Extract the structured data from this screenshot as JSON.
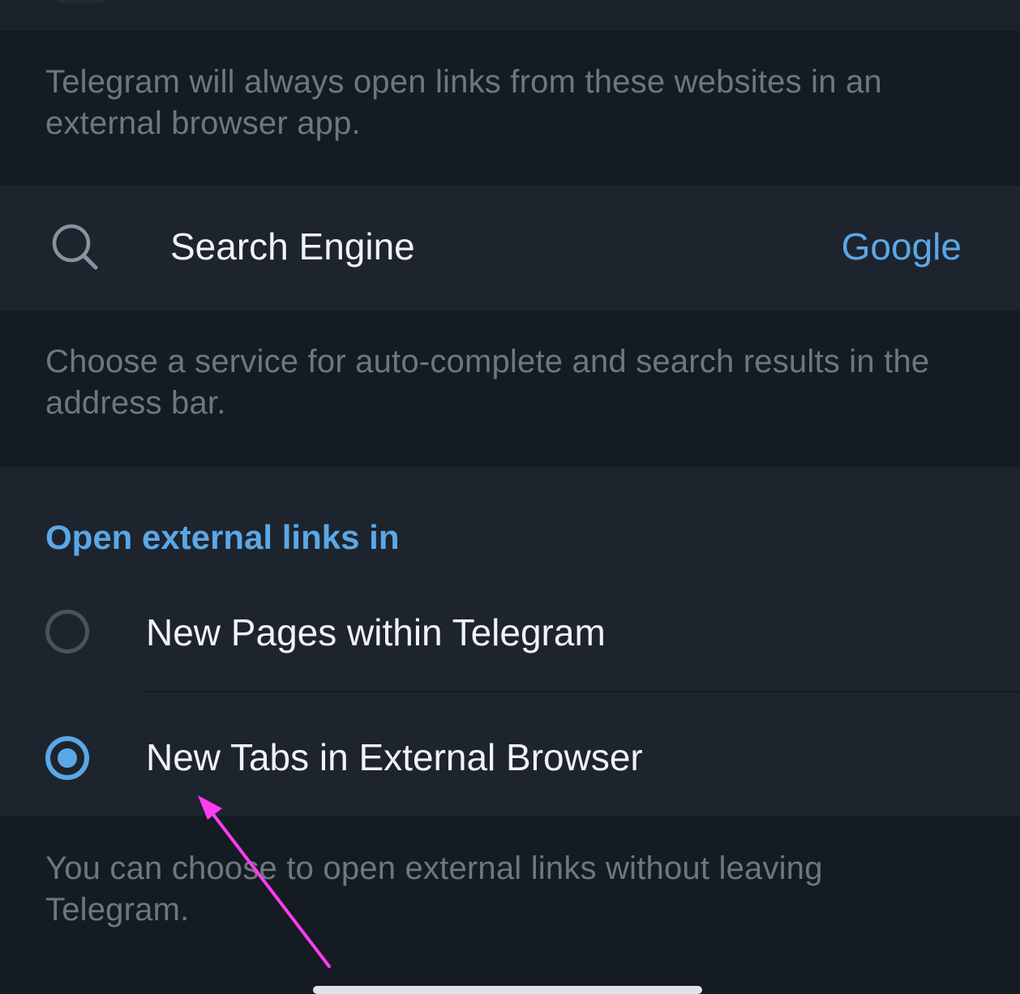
{
  "external_sites_info": "Telegram will always open links from these websites in an external browser app.",
  "search_engine": {
    "label": "Search Engine",
    "value": "Google",
    "icon": "search-icon",
    "info": "Choose a service for auto-complete and search results in the address bar."
  },
  "open_links": {
    "header": "Open external links in",
    "options": [
      {
        "label": "New Pages within Telegram",
        "selected": false
      },
      {
        "label": "New Tabs in External Browser",
        "selected": true
      }
    ],
    "info": "You can choose to open external links without leaving Telegram."
  },
  "colors": {
    "background": "#151b22",
    "row_background": "#1d242e",
    "accent": "#5ba7e6",
    "primary_text": "#f0f3f5",
    "secondary_text": "#6d7782",
    "annotation_arrow": "#ff3cf0"
  }
}
